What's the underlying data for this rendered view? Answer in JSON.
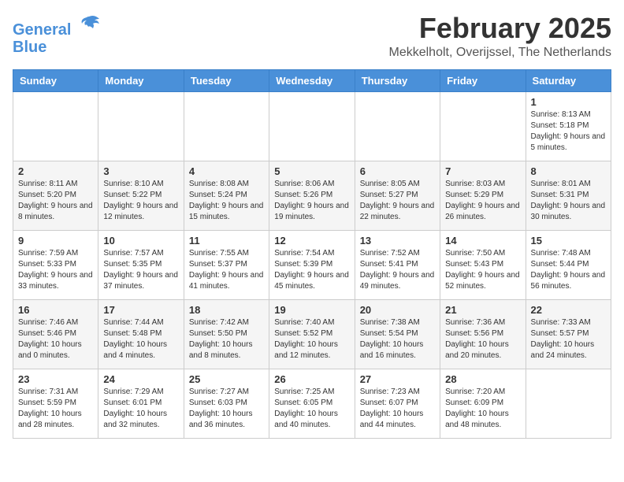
{
  "header": {
    "logo_line1": "General",
    "logo_line2": "Blue",
    "month_title": "February 2025",
    "location": "Mekkelholt, Overijssel, The Netherlands"
  },
  "columns": [
    "Sunday",
    "Monday",
    "Tuesday",
    "Wednesday",
    "Thursday",
    "Friday",
    "Saturday"
  ],
  "weeks": [
    [
      {
        "day": "",
        "detail": ""
      },
      {
        "day": "",
        "detail": ""
      },
      {
        "day": "",
        "detail": ""
      },
      {
        "day": "",
        "detail": ""
      },
      {
        "day": "",
        "detail": ""
      },
      {
        "day": "",
        "detail": ""
      },
      {
        "day": "1",
        "detail": "Sunrise: 8:13 AM\nSunset: 5:18 PM\nDaylight: 9 hours\nand 5 minutes."
      }
    ],
    [
      {
        "day": "2",
        "detail": "Sunrise: 8:11 AM\nSunset: 5:20 PM\nDaylight: 9 hours\nand 8 minutes."
      },
      {
        "day": "3",
        "detail": "Sunrise: 8:10 AM\nSunset: 5:22 PM\nDaylight: 9 hours\nand 12 minutes."
      },
      {
        "day": "4",
        "detail": "Sunrise: 8:08 AM\nSunset: 5:24 PM\nDaylight: 9 hours\nand 15 minutes."
      },
      {
        "day": "5",
        "detail": "Sunrise: 8:06 AM\nSunset: 5:26 PM\nDaylight: 9 hours\nand 19 minutes."
      },
      {
        "day": "6",
        "detail": "Sunrise: 8:05 AM\nSunset: 5:27 PM\nDaylight: 9 hours\nand 22 minutes."
      },
      {
        "day": "7",
        "detail": "Sunrise: 8:03 AM\nSunset: 5:29 PM\nDaylight: 9 hours\nand 26 minutes."
      },
      {
        "day": "8",
        "detail": "Sunrise: 8:01 AM\nSunset: 5:31 PM\nDaylight: 9 hours\nand 30 minutes."
      }
    ],
    [
      {
        "day": "9",
        "detail": "Sunrise: 7:59 AM\nSunset: 5:33 PM\nDaylight: 9 hours\nand 33 minutes."
      },
      {
        "day": "10",
        "detail": "Sunrise: 7:57 AM\nSunset: 5:35 PM\nDaylight: 9 hours\nand 37 minutes."
      },
      {
        "day": "11",
        "detail": "Sunrise: 7:55 AM\nSunset: 5:37 PM\nDaylight: 9 hours\nand 41 minutes."
      },
      {
        "day": "12",
        "detail": "Sunrise: 7:54 AM\nSunset: 5:39 PM\nDaylight: 9 hours\nand 45 minutes."
      },
      {
        "day": "13",
        "detail": "Sunrise: 7:52 AM\nSunset: 5:41 PM\nDaylight: 9 hours\nand 49 minutes."
      },
      {
        "day": "14",
        "detail": "Sunrise: 7:50 AM\nSunset: 5:43 PM\nDaylight: 9 hours\nand 52 minutes."
      },
      {
        "day": "15",
        "detail": "Sunrise: 7:48 AM\nSunset: 5:44 PM\nDaylight: 9 hours\nand 56 minutes."
      }
    ],
    [
      {
        "day": "16",
        "detail": "Sunrise: 7:46 AM\nSunset: 5:46 PM\nDaylight: 10 hours\nand 0 minutes."
      },
      {
        "day": "17",
        "detail": "Sunrise: 7:44 AM\nSunset: 5:48 PM\nDaylight: 10 hours\nand 4 minutes."
      },
      {
        "day": "18",
        "detail": "Sunrise: 7:42 AM\nSunset: 5:50 PM\nDaylight: 10 hours\nand 8 minutes."
      },
      {
        "day": "19",
        "detail": "Sunrise: 7:40 AM\nSunset: 5:52 PM\nDaylight: 10 hours\nand 12 minutes."
      },
      {
        "day": "20",
        "detail": "Sunrise: 7:38 AM\nSunset: 5:54 PM\nDaylight: 10 hours\nand 16 minutes."
      },
      {
        "day": "21",
        "detail": "Sunrise: 7:36 AM\nSunset: 5:56 PM\nDaylight: 10 hours\nand 20 minutes."
      },
      {
        "day": "22",
        "detail": "Sunrise: 7:33 AM\nSunset: 5:57 PM\nDaylight: 10 hours\nand 24 minutes."
      }
    ],
    [
      {
        "day": "23",
        "detail": "Sunrise: 7:31 AM\nSunset: 5:59 PM\nDaylight: 10 hours\nand 28 minutes."
      },
      {
        "day": "24",
        "detail": "Sunrise: 7:29 AM\nSunset: 6:01 PM\nDaylight: 10 hours\nand 32 minutes."
      },
      {
        "day": "25",
        "detail": "Sunrise: 7:27 AM\nSunset: 6:03 PM\nDaylight: 10 hours\nand 36 minutes."
      },
      {
        "day": "26",
        "detail": "Sunrise: 7:25 AM\nSunset: 6:05 PM\nDaylight: 10 hours\nand 40 minutes."
      },
      {
        "day": "27",
        "detail": "Sunrise: 7:23 AM\nSunset: 6:07 PM\nDaylight: 10 hours\nand 44 minutes."
      },
      {
        "day": "28",
        "detail": "Sunrise: 7:20 AM\nSunset: 6:09 PM\nDaylight: 10 hours\nand 48 minutes."
      },
      {
        "day": "",
        "detail": ""
      }
    ]
  ]
}
